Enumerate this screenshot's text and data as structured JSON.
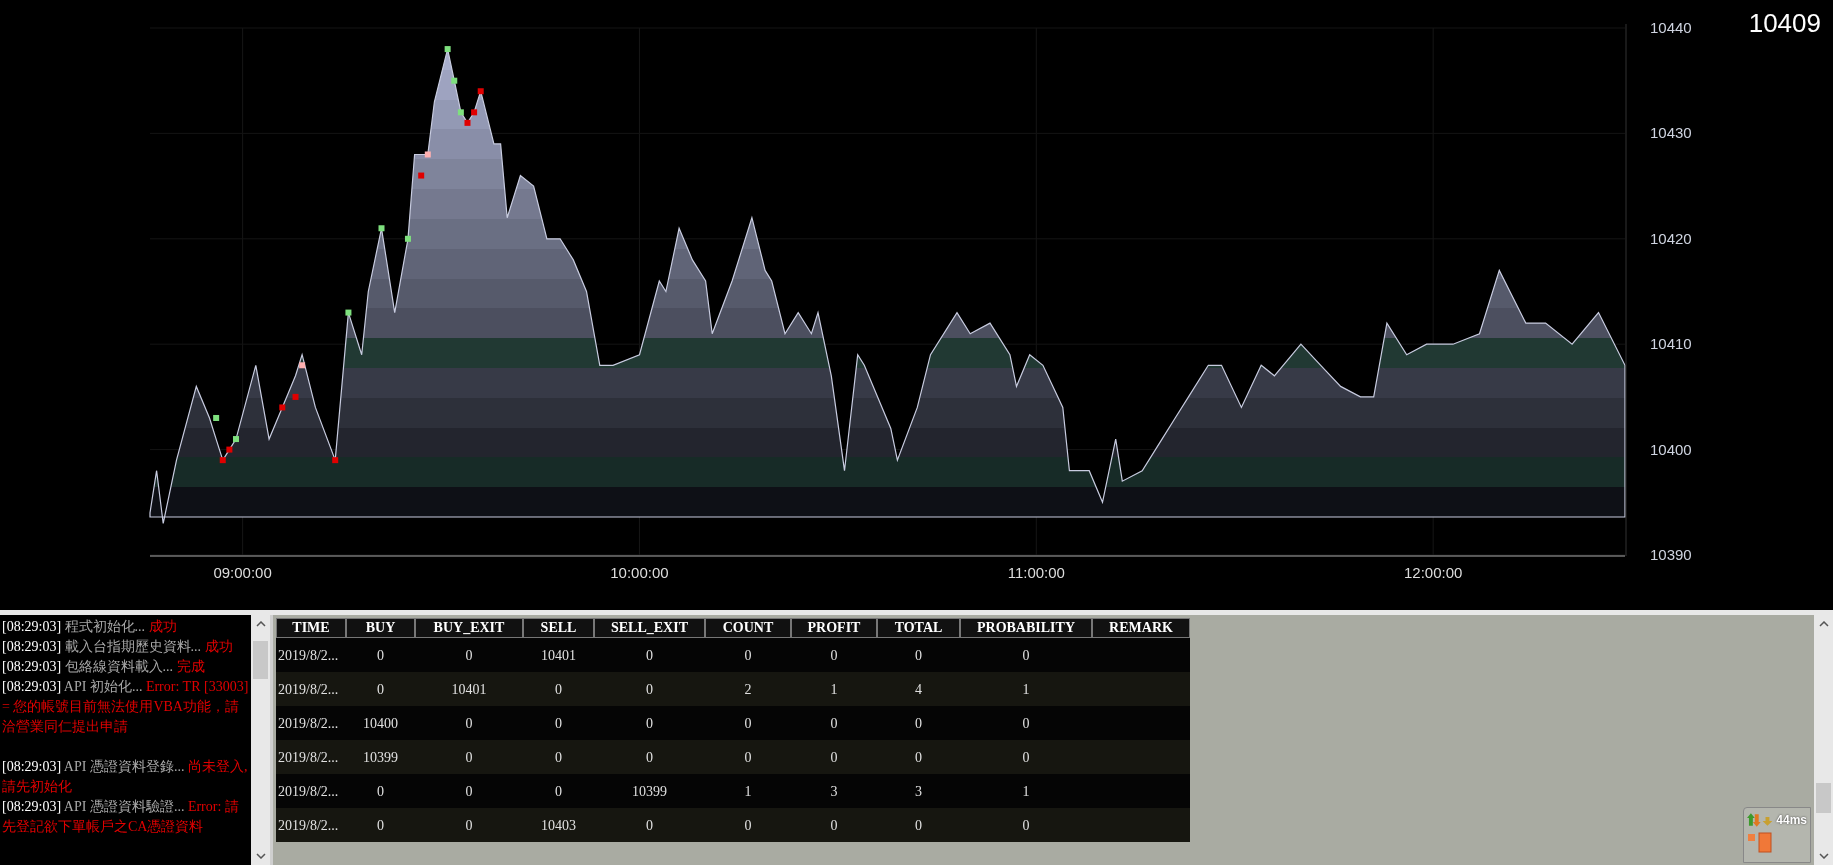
{
  "chart": {
    "current_price": "10409",
    "chart_data": {
      "type": "area",
      "x": [
        526,
        527,
        528,
        530,
        533,
        535,
        536,
        537,
        538,
        539,
        542,
        544,
        546,
        548,
        549,
        551,
        554,
        556,
        558,
        559,
        561,
        563,
        565,
        566,
        567,
        568,
        569,
        571,
        572,
        573,
        574,
        575,
        576,
        578,
        579,
        580,
        582,
        584,
        586,
        588,
        590,
        592,
        594,
        596,
        600,
        603,
        604,
        606,
        608,
        610,
        611,
        614,
        617,
        619,
        620,
        622,
        624,
        626,
        627,
        629,
        631,
        633,
        634,
        636,
        638,
        639,
        642,
        644,
        648,
        650,
        653,
        656,
        657,
        659,
        661,
        664,
        665,
        668,
        670,
        672,
        673,
        676,
        679,
        681,
        683,
        686,
        688,
        691,
        694,
        696,
        700,
        703,
        706,
        709,
        711,
        713,
        716,
        719,
        723,
        727,
        730,
        734,
        737,
        741,
        745,
        749
      ],
      "series": [
        {
          "color": "#c8cce0",
          "values": [
            10394,
            10398,
            10393,
            10399,
            10406,
            10403,
            10401,
            10399,
            10400,
            10401,
            10408,
            10401,
            10404,
            10407,
            10409,
            10404,
            10399,
            10413,
            10409,
            10415,
            10421,
            10413,
            10420,
            10428,
            10428,
            10428,
            10433,
            10438,
            10435,
            10432,
            10431,
            10432,
            10434,
            10429,
            10429,
            10422,
            10426,
            10425,
            10420,
            10420,
            10418,
            10415,
            10408,
            10408,
            10409,
            10416,
            10415,
            10421,
            10418,
            10416,
            10411,
            10416,
            10422,
            10417,
            10416,
            10411,
            10413,
            10411,
            10413,
            10407,
            10398,
            10409,
            10408,
            10405,
            10402,
            10399,
            10404,
            10409,
            10413,
            10411,
            10412,
            10409,
            10406,
            10409,
            10408,
            10404,
            10398,
            10398,
            10395,
            10401,
            10397,
            10398,
            10401,
            10403,
            10405,
            10408,
            10408,
            10404,
            10408,
            10407,
            10410,
            10408,
            10406,
            10405,
            10405,
            10412,
            10409,
            10410,
            10410,
            10411,
            10417,
            10412,
            10412,
            10410,
            10413,
            10408
          ]
        },
        {
          "type": "scatter",
          "color": "#7ee07e",
          "values": [
            null,
            null,
            null,
            null,
            null,
            null,
            10403,
            null,
            null,
            10401,
            null,
            null,
            null,
            null,
            null,
            null,
            null,
            10413,
            null,
            null,
            10421,
            null,
            10420,
            null,
            null,
            null,
            null,
            10438,
            10435,
            10432,
            null,
            null,
            null,
            null,
            null,
            null,
            null,
            null,
            null,
            null,
            null,
            null,
            null,
            null,
            null,
            null,
            null,
            null,
            null,
            null,
            null,
            null,
            null,
            null,
            null,
            null,
            null,
            null,
            null,
            null,
            null,
            null,
            null,
            null,
            null,
            null,
            null,
            null,
            null,
            null,
            null,
            null,
            null,
            null,
            null,
            null,
            null,
            null,
            null,
            null,
            null,
            null,
            null,
            null,
            null,
            null,
            null,
            null,
            null,
            null,
            null,
            null,
            null,
            null,
            null,
            null,
            null,
            null,
            null,
            null,
            null,
            null,
            null,
            null,
            null,
            null
          ]
        },
        {
          "type": "scatter",
          "color": "#e00000",
          "values": [
            null,
            null,
            null,
            null,
            null,
            null,
            null,
            10399,
            10400,
            null,
            null,
            null,
            10404,
            10405,
            null,
            null,
            10399,
            null,
            null,
            null,
            null,
            null,
            null,
            null,
            10426,
            null,
            null,
            null,
            null,
            null,
            10431,
            10432,
            10434,
            null,
            null,
            null,
            null,
            null,
            null,
            null,
            null,
            null,
            null,
            null,
            null,
            null,
            null,
            null,
            null,
            null,
            null,
            null,
            null,
            null,
            null,
            null,
            null,
            null,
            null,
            null,
            null,
            null,
            null,
            null,
            null,
            null,
            null,
            null,
            null,
            null,
            null,
            null,
            null,
            null,
            null,
            null,
            null,
            null,
            null,
            null,
            null,
            null,
            null,
            null,
            null,
            null,
            null,
            null,
            null,
            null,
            null,
            null,
            null,
            null,
            null,
            null,
            null,
            null,
            null,
            null,
            null,
            null,
            null,
            null,
            null,
            null
          ]
        },
        {
          "type": "scatter",
          "color": "#ffb0b0",
          "values": [
            null,
            null,
            null,
            null,
            null,
            null,
            null,
            null,
            null,
            null,
            null,
            null,
            null,
            null,
            10408,
            null,
            null,
            null,
            null,
            null,
            null,
            null,
            null,
            null,
            null,
            10428,
            null,
            null,
            null,
            null,
            null,
            null,
            null,
            null,
            null,
            null,
            null,
            null,
            null,
            null,
            null,
            null,
            null,
            null,
            null,
            null,
            null,
            null,
            null,
            null,
            null,
            null,
            null,
            null,
            null,
            null,
            null,
            null,
            null,
            null,
            null,
            null,
            null,
            null,
            null,
            null,
            null,
            null,
            null,
            null,
            null,
            null,
            null,
            null,
            null,
            null,
            null,
            null,
            null,
            null,
            null,
            null,
            null,
            null,
            null,
            null,
            null,
            null,
            null,
            null,
            null,
            null,
            null,
            null,
            null,
            null,
            null,
            null,
            null,
            null,
            null,
            null,
            null,
            null,
            null,
            null
          ]
        }
      ],
      "grid": true,
      "xlim": [
        526,
        749
      ],
      "ylim": [
        10390,
        10440
      ],
      "yticks": [
        10390,
        10400,
        10410,
        10420,
        10430,
        10440
      ],
      "xticks": [
        {
          "value": 540,
          "label": "09:00:00"
        },
        {
          "value": 600,
          "label": "10:00:00"
        },
        {
          "value": 660,
          "label": "11:00:00"
        },
        {
          "value": 720,
          "label": "12:00:00"
        }
      ]
    }
  },
  "log": [
    {
      "time": "[08:29:03]",
      "message": "程式初始化...",
      "status": "成功"
    },
    {
      "time": "[08:29:03]",
      "message": "載入台指期歷史資料...",
      "status": "成功"
    },
    {
      "time": "[08:29:03]",
      "message": "包絡線資料載入...",
      "status": "完成"
    },
    {
      "time": "[08:29:03]",
      "message": "API 初始化...",
      "status": "Error: TR [33003] = 您的帳號目前無法使用VBA功能，請洽營業同仁提出申請"
    },
    {
      "time": "[08:29:03]",
      "message": "API 憑證資料登錄...",
      "status": "尚未登入, 請先初始化"
    },
    {
      "time": "[08:29:03]",
      "message": "API 憑證資料驗證...",
      "status": "Error: 請先登記欲下單帳戶之CA憑證資料"
    }
  ],
  "table": {
    "columns": [
      "TIME",
      "BUY",
      "BUY_EXIT",
      "SELL",
      "SELL_EXIT",
      "COUNT",
      "PROFIT",
      "TOTAL",
      "PROBABILITY",
      "REMARK"
    ],
    "rows": [
      [
        "2019/8/2...",
        "0",
        "0",
        "10401",
        "0",
        "0",
        "0",
        "0",
        "0"
      ],
      [
        "2019/8/2...",
        "0",
        "10401",
        "0",
        "0",
        "2",
        "1",
        "4",
        "1"
      ],
      [
        "2019/8/2...",
        "10400",
        "0",
        "0",
        "0",
        "0",
        "0",
        "0",
        "0"
      ],
      [
        "2019/8/2...",
        "10399",
        "0",
        "0",
        "0",
        "0",
        "0",
        "0",
        "0"
      ],
      [
        "2019/8/2...",
        "0",
        "0",
        "0",
        "10399",
        "1",
        "3",
        "3",
        "1"
      ],
      [
        "2019/8/2...",
        "0",
        "0",
        "10403",
        "0",
        "0",
        "0",
        "0",
        "0"
      ]
    ]
  },
  "status_widget": {
    "latency": "44ms"
  }
}
